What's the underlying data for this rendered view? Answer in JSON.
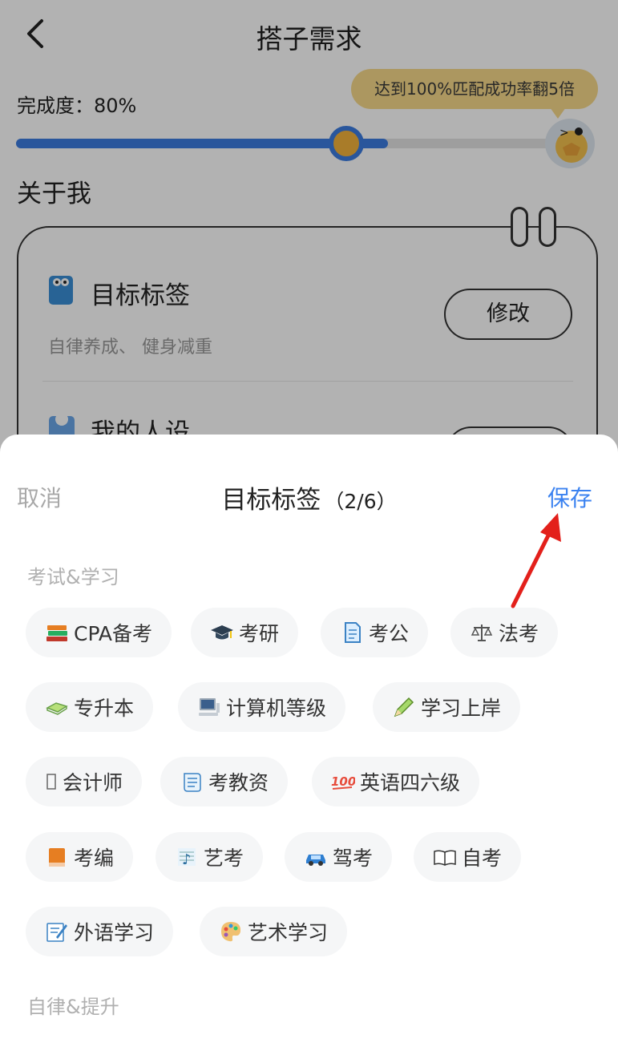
{
  "nav": {
    "title": "搭子需求"
  },
  "progress": {
    "label": "完成度：80%",
    "value_percent": 80,
    "tip": "达到100%匹配成功率翻5倍",
    "fill_color": "#3b7be0"
  },
  "about": {
    "section_title": "关于我",
    "rows": [
      {
        "title": "目标标签",
        "subtitle": "自律养成、 健身减重",
        "button": "修改"
      },
      {
        "title": "我的人设"
      }
    ]
  },
  "sheet": {
    "cancel": "取消",
    "title": "目标标签",
    "count": "（2/6）",
    "save": "保存",
    "save_color": "#3b82f0",
    "categories": [
      {
        "label": "考试&学习"
      },
      {
        "label": "自律&提升"
      }
    ],
    "tags": [
      {
        "label": "CPA备考",
        "icon": "books-icon"
      },
      {
        "label": "考研",
        "icon": "graduation-cap-icon"
      },
      {
        "label": "考公",
        "icon": "document-icon"
      },
      {
        "label": "法考",
        "icon": "scales-icon"
      },
      {
        "label": "专升本",
        "icon": "book-green-icon"
      },
      {
        "label": "计算机等级",
        "icon": "computer-icon"
      },
      {
        "label": "学习上岸",
        "icon": "pencil-icon"
      },
      {
        "label": "会计师",
        "icon": "missing-glyph-icon"
      },
      {
        "label": "考教资",
        "icon": "scroll-icon"
      },
      {
        "label": "英语四六级",
        "icon": "hundred-points-icon"
      },
      {
        "label": "考编",
        "icon": "book-orange-icon"
      },
      {
        "label": "艺考",
        "icon": "music-score-icon"
      },
      {
        "label": "驾考",
        "icon": "car-icon"
      },
      {
        "label": "自考",
        "icon": "open-book-icon"
      },
      {
        "label": "外语学习",
        "icon": "memo-icon"
      },
      {
        "label": "艺术学习",
        "icon": "palette-icon"
      }
    ]
  }
}
